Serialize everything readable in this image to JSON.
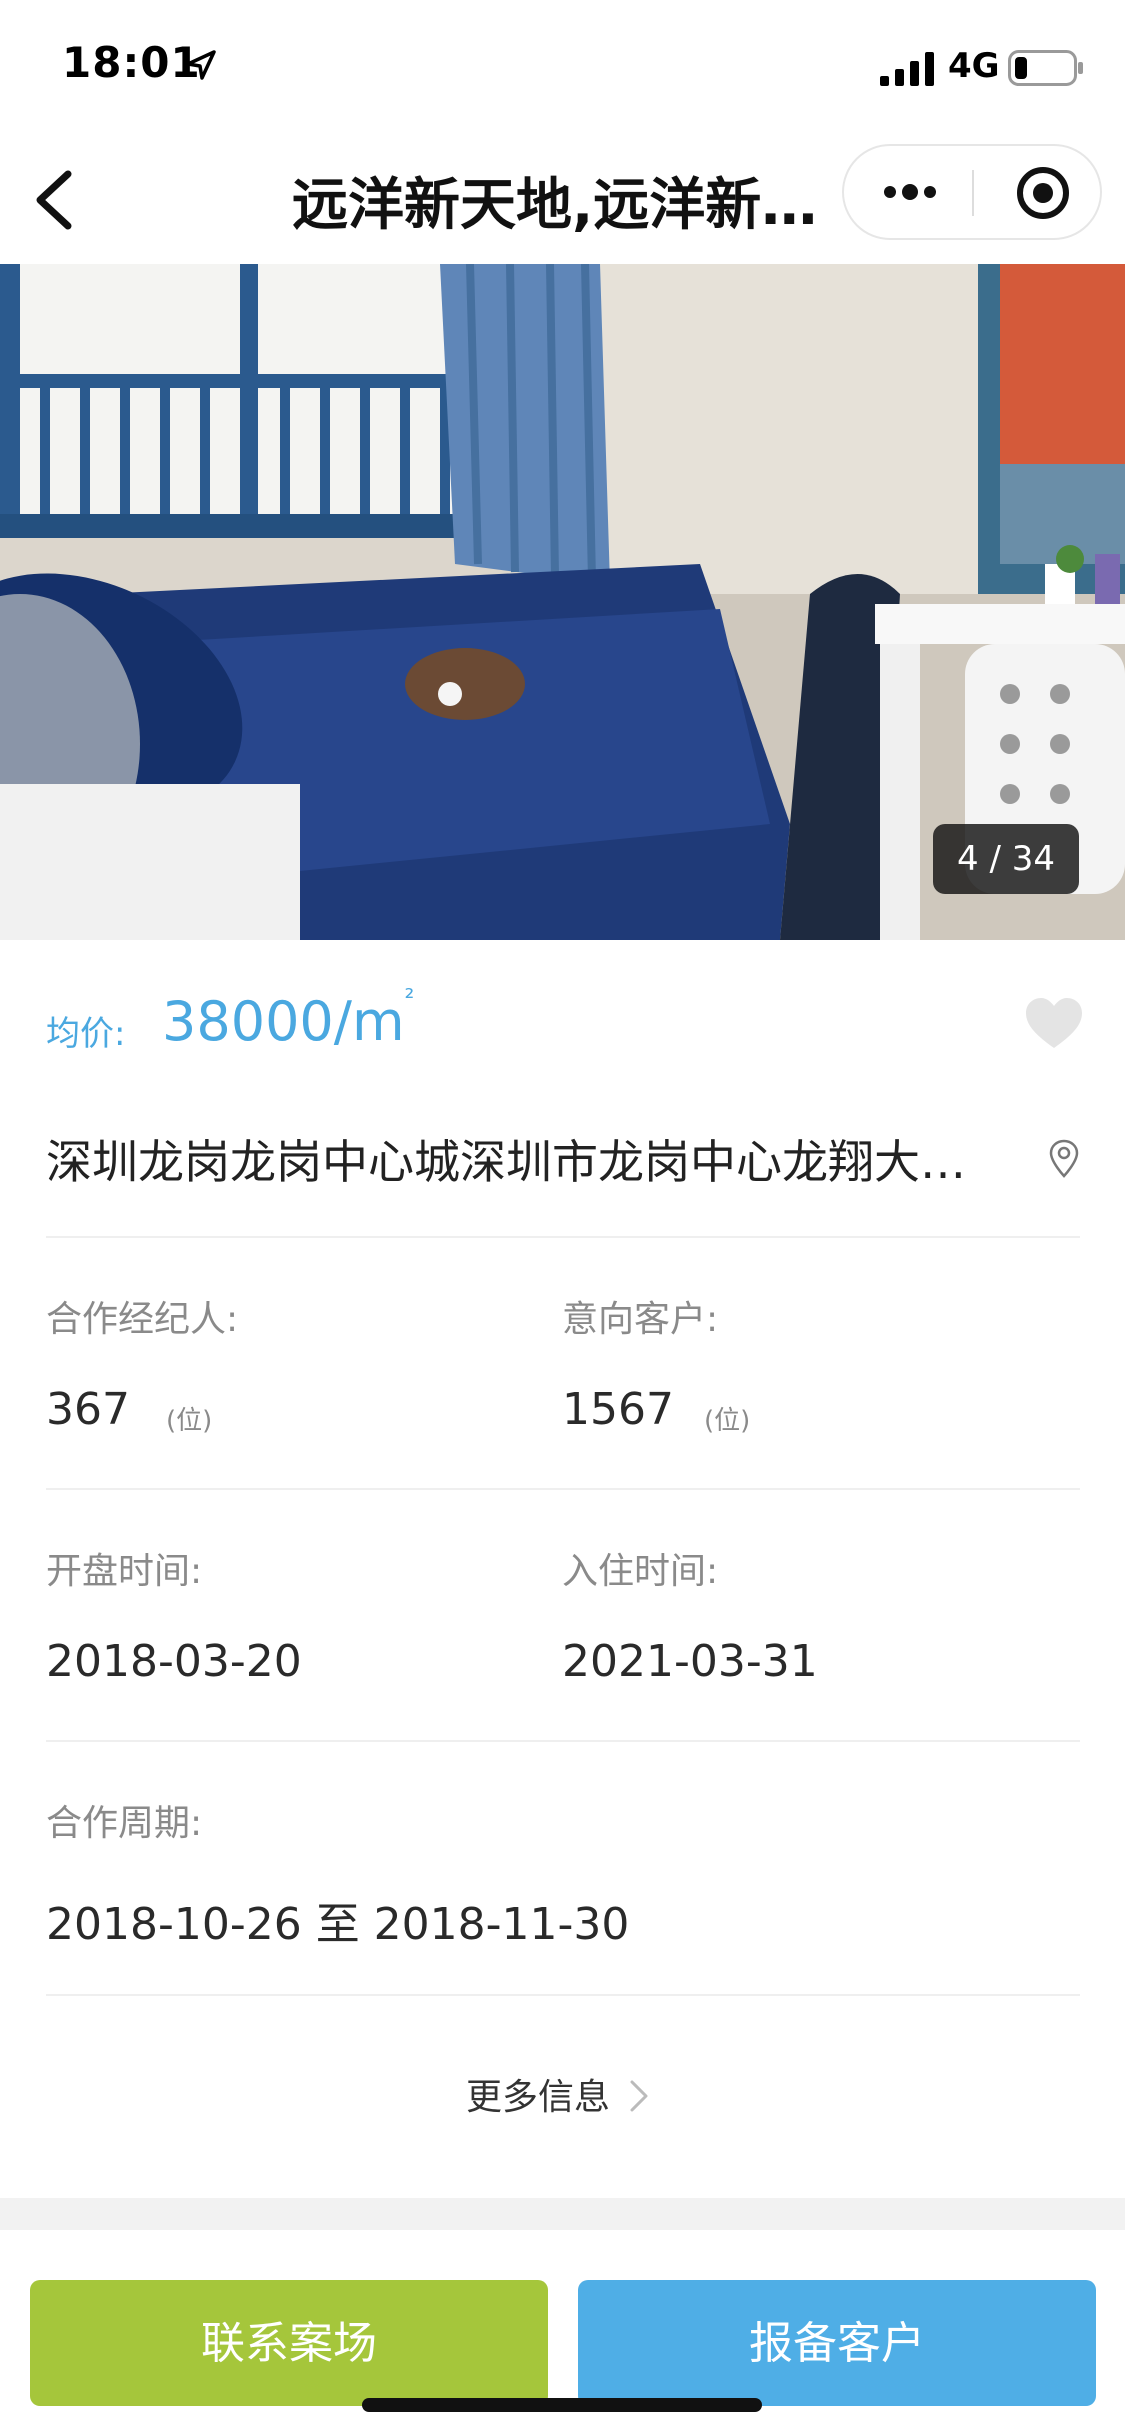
{
  "status_bar": {
    "time": "18:01",
    "network": "4G"
  },
  "nav": {
    "title": "远洋新天地,远洋新…"
  },
  "gallery": {
    "counter": "4 / 34"
  },
  "price": {
    "label": "均价:",
    "value": "38000/m",
    "unit_superscript": "²"
  },
  "address": "深圳龙岗龙岗中心城深圳市龙岗中心龙翔大…",
  "details": {
    "agents_label": "合作经纪人:",
    "agents_value": "367",
    "agents_unit": "(位)",
    "clients_label": "意向客户:",
    "clients_value": "1567",
    "clients_unit": "(位)",
    "open_label": "开盘时间:",
    "open_value": "2018-03-20",
    "move_in_label": "入住时间:",
    "move_in_value": "2021-03-31",
    "period_label": "合作周期:",
    "period_value": "2018-10-26 至 2018-11-30"
  },
  "more_info": "更多信息",
  "buttons": {
    "contact": "联系案场",
    "report": "报备客户"
  },
  "colors": {
    "price": "#4aa8e0",
    "contact_button": "#a5c63b",
    "report_button": "#4faee6"
  },
  "icons": {
    "back": "chevron-left-icon",
    "more": "more-dots-icon",
    "close": "target-close-icon",
    "favorite": "heart-icon",
    "location": "location-pin-icon",
    "more_info": "chevron-right-icon"
  }
}
